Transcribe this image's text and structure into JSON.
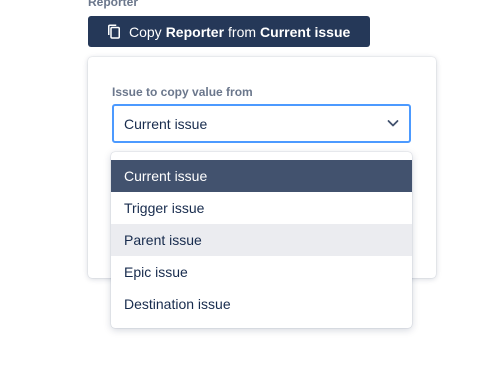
{
  "section": {
    "label": "Reporter"
  },
  "copy_chip": {
    "icon": "copy-icon",
    "prefix": "Copy",
    "field": "Reporter",
    "middle": "from",
    "source": "Current issue"
  },
  "form": {
    "field_label": "Issue to copy value from",
    "selected_value": "Current issue",
    "chevron_icon": "chevron-down-icon"
  },
  "dropdown": {
    "options": [
      {
        "label": "Current issue",
        "state": "selected"
      },
      {
        "label": "Trigger issue",
        "state": "normal"
      },
      {
        "label": "Parent issue",
        "state": "hover"
      },
      {
        "label": "Epic issue",
        "state": "normal"
      },
      {
        "label": "Destination issue",
        "state": "normal"
      }
    ]
  },
  "colors": {
    "chip_bg": "#253858",
    "focus_border": "#4c9aff",
    "selected_bg": "#42526e",
    "hover_bg": "#ebecf0"
  }
}
